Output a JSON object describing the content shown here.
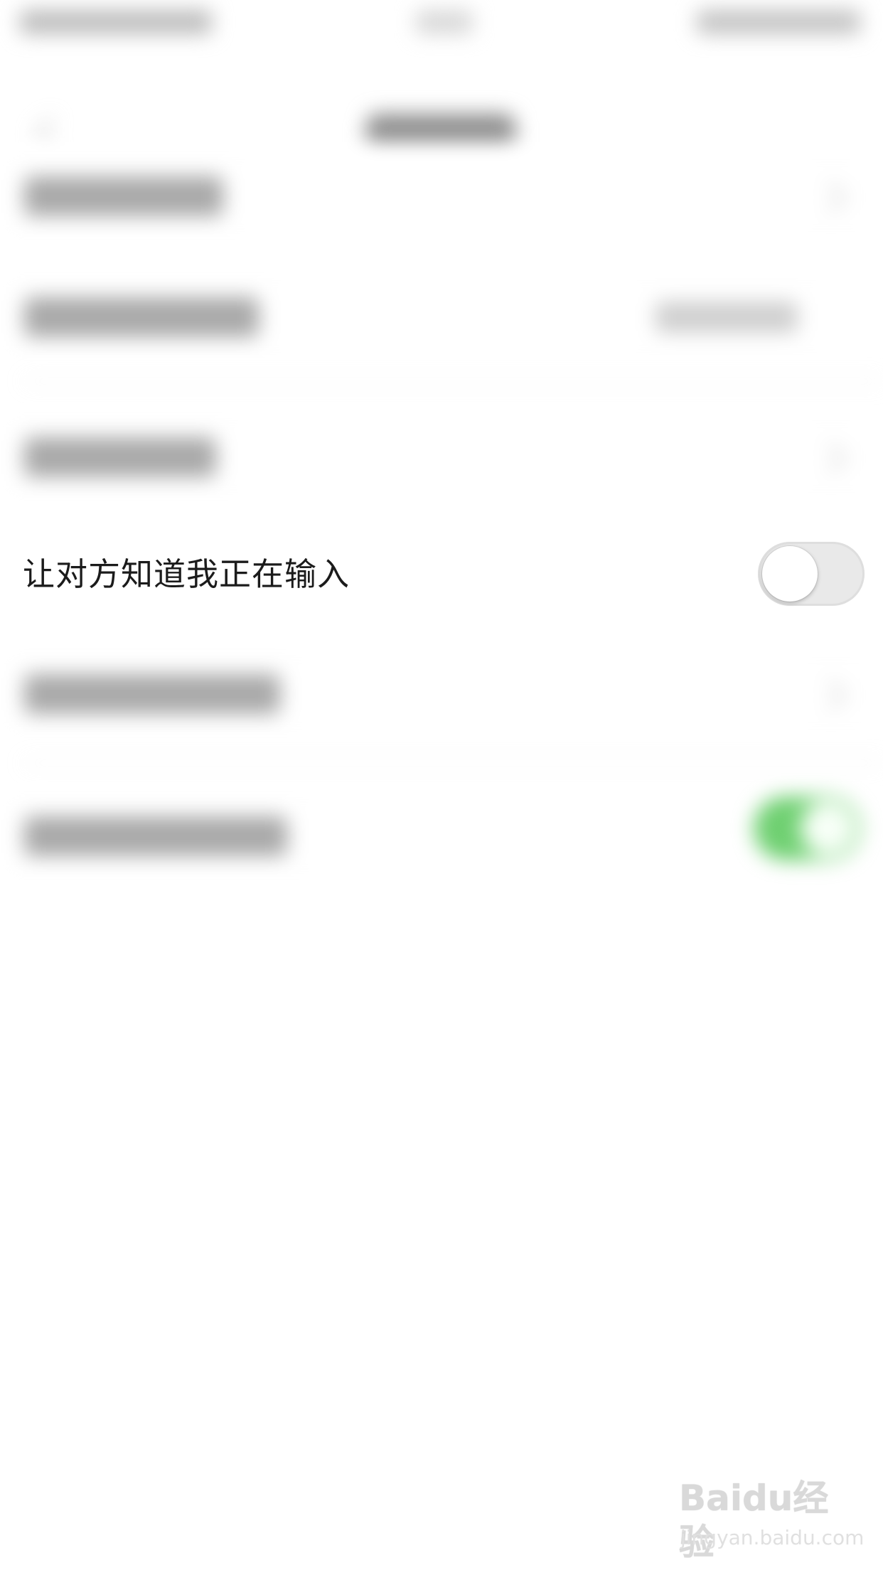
{
  "focused_setting": {
    "label": "让对方知道我正在输入",
    "toggle_state": "off"
  },
  "watermark": {
    "logo_text": "Baidu经验",
    "url_text": "jingyan.baidu.com"
  },
  "colors": {
    "toggle_off_track": "#e9e9e9",
    "toggle_on_track": "#6fd071",
    "background": "#ffffff"
  }
}
